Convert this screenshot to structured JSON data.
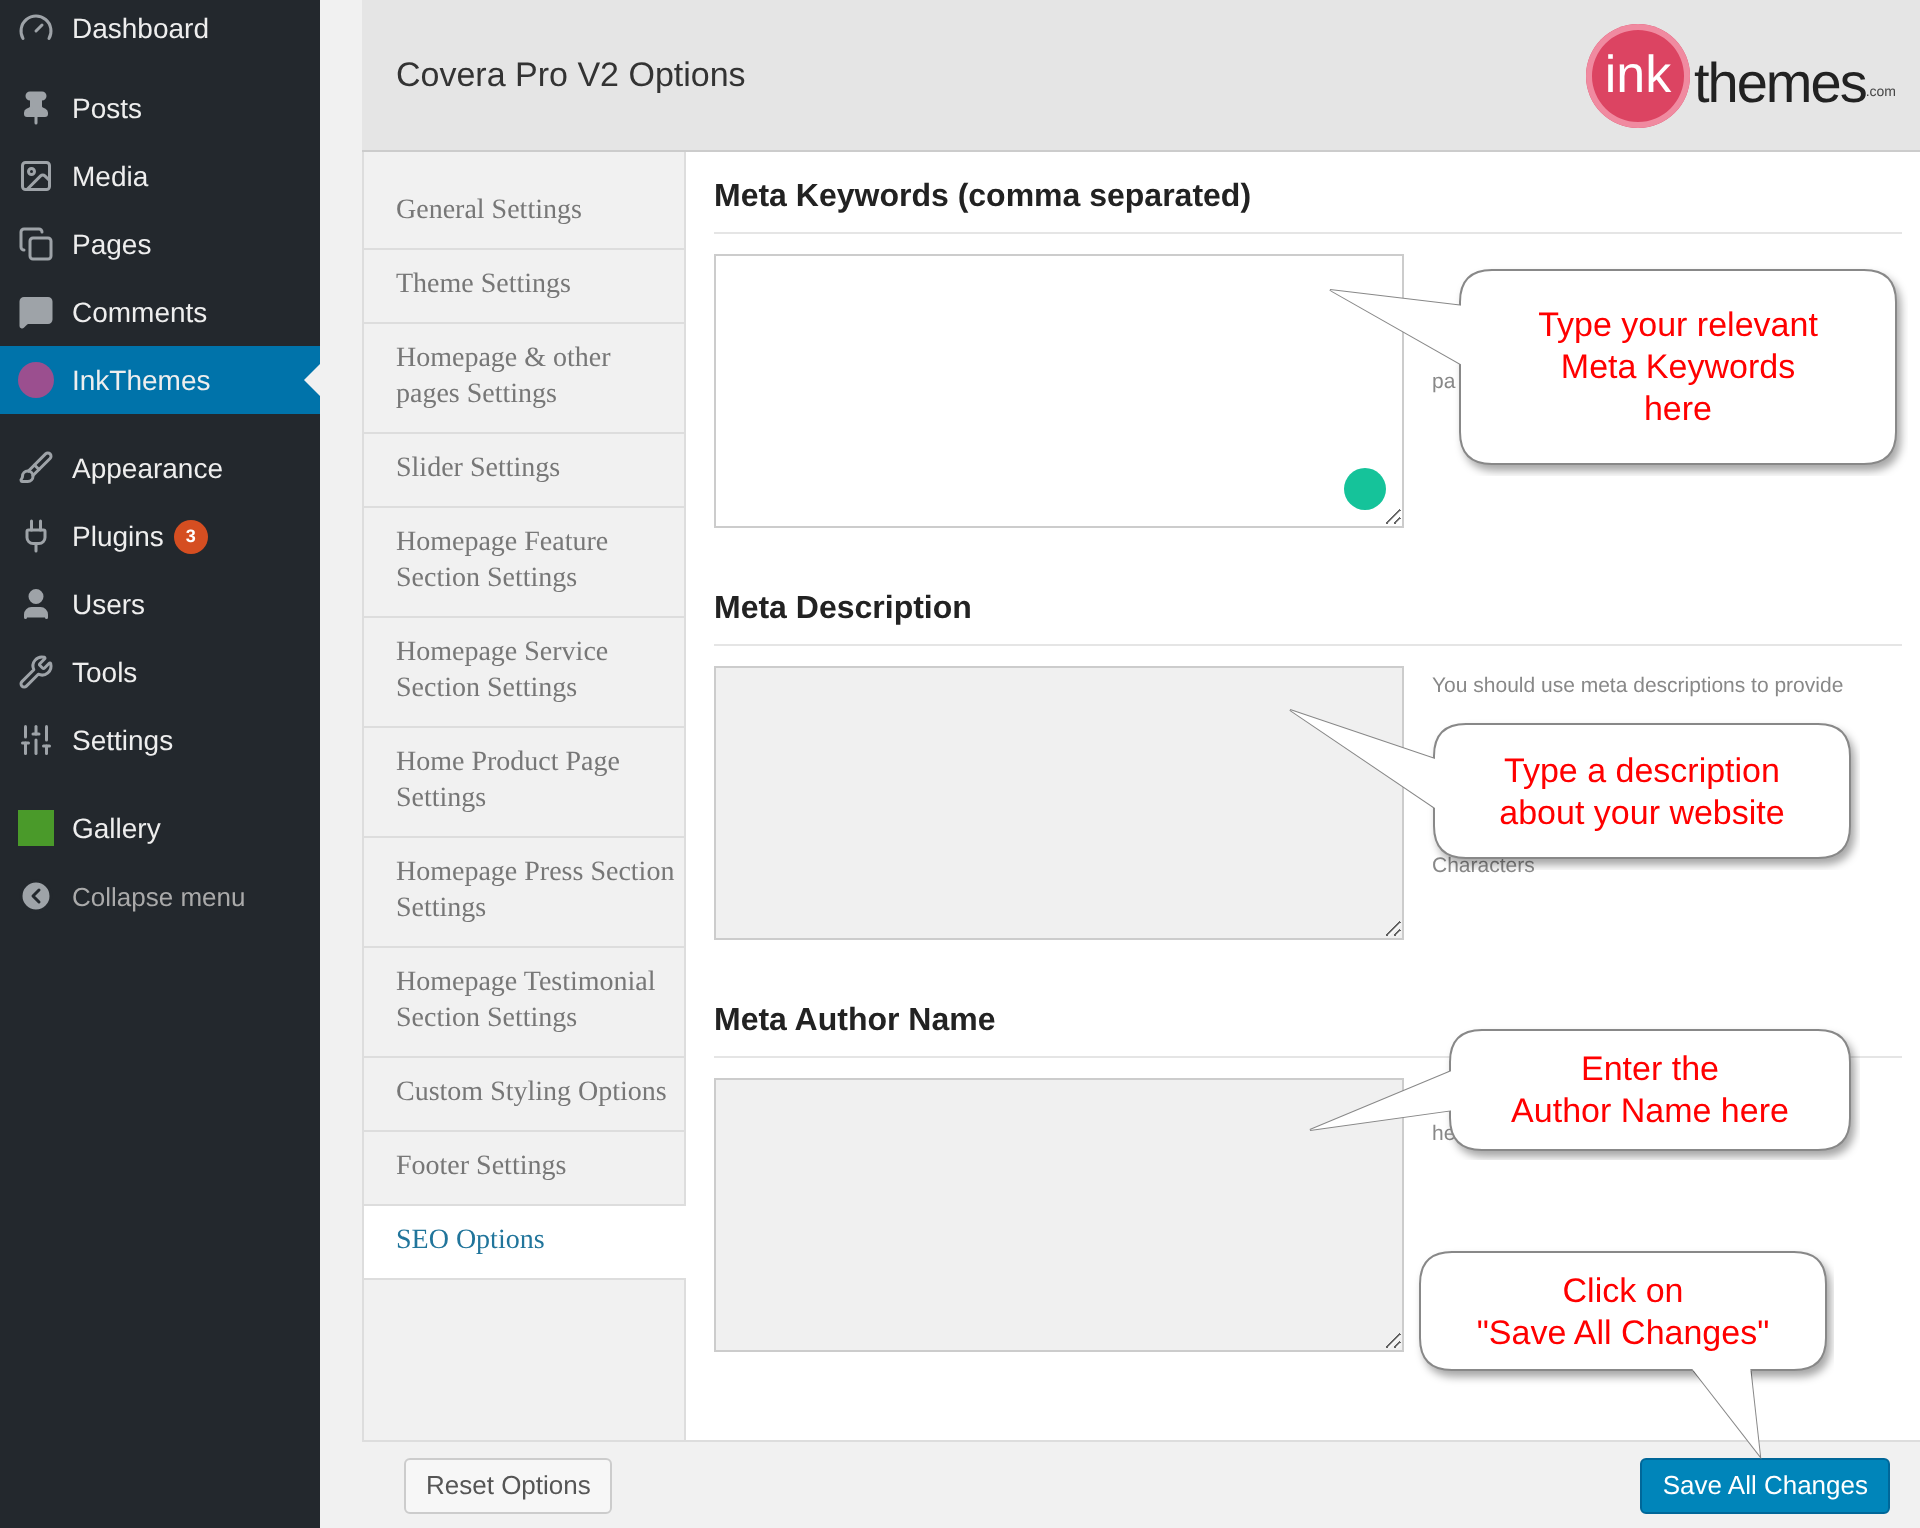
{
  "sidebar": {
    "groups": [
      [
        {
          "label": "Dashboard",
          "selected": false
        }
      ],
      [
        {
          "label": "Posts",
          "selected": false
        },
        {
          "label": "Media",
          "selected": false
        },
        {
          "label": "Pages",
          "selected": false
        },
        {
          "label": "Comments",
          "selected": false
        },
        {
          "label": "InkThemes",
          "selected": true
        }
      ],
      [
        {
          "label": "Appearance",
          "selected": false
        },
        {
          "label": "Plugins",
          "selected": false,
          "badge": "3"
        },
        {
          "label": "Users",
          "selected": false
        },
        {
          "label": "Tools",
          "selected": false
        },
        {
          "label": "Settings",
          "selected": false
        }
      ],
      [
        {
          "label": "Gallery",
          "selected": false
        }
      ]
    ],
    "collapse": "Collapse menu"
  },
  "header": {
    "title": "Covera Pro V2 Options",
    "logo": {
      "mark": "ink",
      "word": "themes",
      "suffix": ".com"
    }
  },
  "tabs": [
    {
      "label": "General Settings",
      "selected": false
    },
    {
      "label": "Theme Settings",
      "selected": false
    },
    {
      "label": "Homepage & other pages Settings",
      "selected": false
    },
    {
      "label": "Slider Settings",
      "selected": false
    },
    {
      "label": "Homepage Feature Section Settings",
      "selected": false
    },
    {
      "label": "Homepage Service Section Settings",
      "selected": false
    },
    {
      "label": "Home Product Page Settings",
      "selected": false
    },
    {
      "label": "Homepage Press Section Settings",
      "selected": false
    },
    {
      "label": "Homepage Testimonial Section Settings",
      "selected": false
    },
    {
      "label": "Custom Styling Options",
      "selected": false
    },
    {
      "label": "Footer Settings",
      "selected": false
    },
    {
      "label": "SEO Options",
      "selected": true
    }
  ],
  "sections": [
    {
      "heading": "Meta Keywords (comma separated)",
      "focused": true,
      "help": [
        "pa"
      ]
    },
    {
      "heading": "Meta Description",
      "focused": false,
      "help": [
        "You should use meta descriptions to provide",
        "Characters"
      ]
    },
    {
      "heading": "Meta Author Name",
      "focused": false,
      "help": [
        "he"
      ]
    }
  ],
  "callouts": [
    {
      "text": "Type your relevant\nMeta Keywords\nhere"
    },
    {
      "text": "Type a description\nabout your website"
    },
    {
      "text": "Enter the\nAuthor Name here"
    },
    {
      "text": "Click on\n\"Save All Changes\""
    }
  ],
  "footer": {
    "reset": "Reset Options",
    "save": "Save All Changes"
  }
}
